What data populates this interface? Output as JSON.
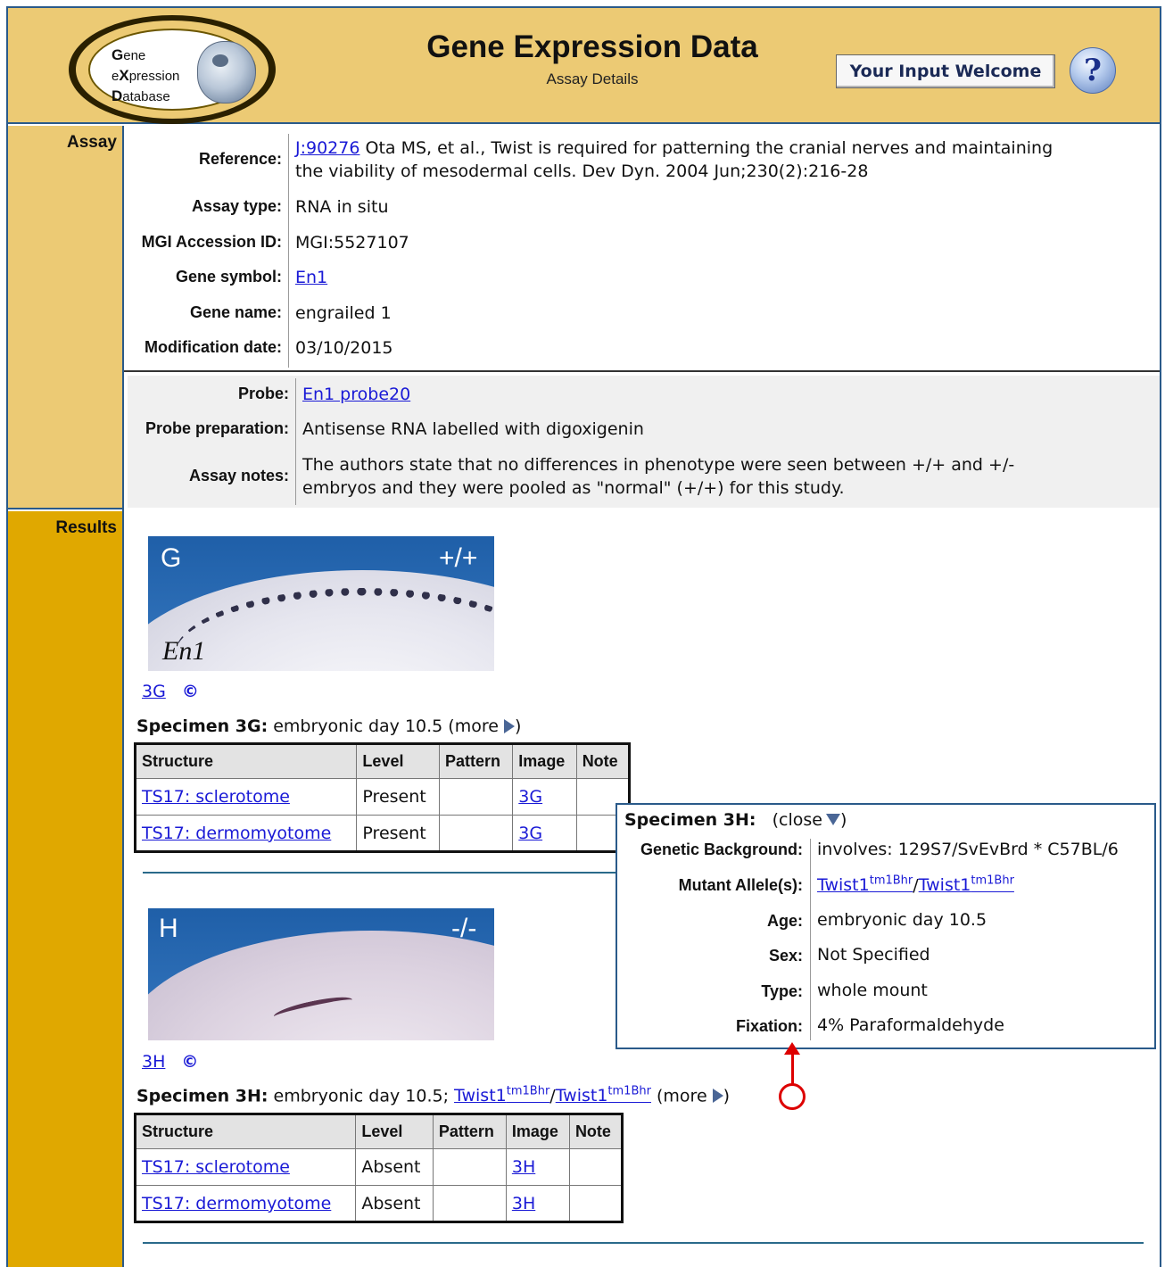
{
  "header": {
    "logo_letters": [
      "G",
      "X",
      "D"
    ],
    "logo_lines": [
      "ene",
      "e",
      "pression",
      "atabase"
    ],
    "title": "Gene Expression Data",
    "subtitle": "Assay Details",
    "input_button": "Your Input Welcome",
    "help_glyph": "?",
    "colors": {
      "header_bg": "#ecca74",
      "results_bg": "#e0a800",
      "border": "#2a5a8a"
    }
  },
  "sections": {
    "assay": "Assay",
    "results": "Results"
  },
  "assay": {
    "reference_label": "Reference:",
    "reference_link": "J:90276",
    "reference_text_1": " Ota MS, et al., Twist is required for patterning the cranial nerves and maintaining",
    "reference_text_2": "the viability of mesodermal cells. Dev Dyn. 2004 Jun;230(2):216-28",
    "assay_type_label": "Assay type:",
    "assay_type": "RNA in situ",
    "mgi_label": "MGI Accession ID:",
    "mgi_id": "MGI:5527107",
    "gene_symbol_label": "Gene symbol:",
    "gene_symbol": "En1",
    "gene_name_label": "Gene name:",
    "gene_name": "engrailed 1",
    "mod_date_label": "Modification date:",
    "mod_date": "03/10/2015",
    "probe_label": "Probe:",
    "probe": "En1 probe20",
    "probe_prep_label": "Probe preparation:",
    "probe_prep": "Antisense RNA labelled with digoxigenin",
    "notes_label": "Assay notes:",
    "notes_1": "The authors state that no differences in phenotype were seen between +/+ and +/-",
    "notes_2": "embryos and they were pooled as \"normal\" (+/+) for this study."
  },
  "results": {
    "image_g": {
      "letter": "G",
      "genotype": "+/+",
      "gene": "En1",
      "link": "3G",
      "copyright": "©"
    },
    "image_h": {
      "letter": "H",
      "genotype": "-/-",
      "link": "3H",
      "copyright": "©"
    },
    "spec_g": {
      "label": "Specimen 3G:",
      "text": " embryonic day 10.5 (more"
    },
    "spec_h": {
      "label": "Specimen 3H:",
      "text": " embryonic day 10.5; ",
      "allele": "Twist1",
      "allele_sup": "tm1Bhr",
      "slash": "/",
      "more": " (more"
    },
    "table_headers": [
      "Structure",
      "Level",
      "Pattern",
      "Image",
      "Note"
    ],
    "table_g": [
      {
        "structure": "TS17: sclerotome",
        "level": "Present",
        "pattern": "",
        "image": "3G",
        "note": ""
      },
      {
        "structure": "TS17: dermomyotome",
        "level": "Present",
        "pattern": "",
        "image": "3G",
        "note": ""
      }
    ],
    "table_h": [
      {
        "structure": "TS17: sclerotome",
        "level": "Absent",
        "pattern": "",
        "image": "3H",
        "note": ""
      },
      {
        "structure": "TS17: dermomyotome",
        "level": "Absent",
        "pattern": "",
        "image": "3H",
        "note": ""
      }
    ]
  },
  "popup": {
    "title": "Specimen 3H:",
    "close": "(close",
    "genetic_bg_label": "Genetic Background:",
    "genetic_bg": "involves: 129S7/SvEvBrd * C57BL/6",
    "mutant_label": "Mutant Allele(s):",
    "mutant_allele": "Twist1",
    "mutant_sup": "tm1Bhr",
    "age_label": "Age:",
    "age": "embryonic day 10.5",
    "sex_label": "Sex:",
    "sex": "Not Specified",
    "type_label": "Type:",
    "type": "whole mount",
    "fixation_label": "Fixation:",
    "fixation": "4% Paraformaldehyde"
  }
}
